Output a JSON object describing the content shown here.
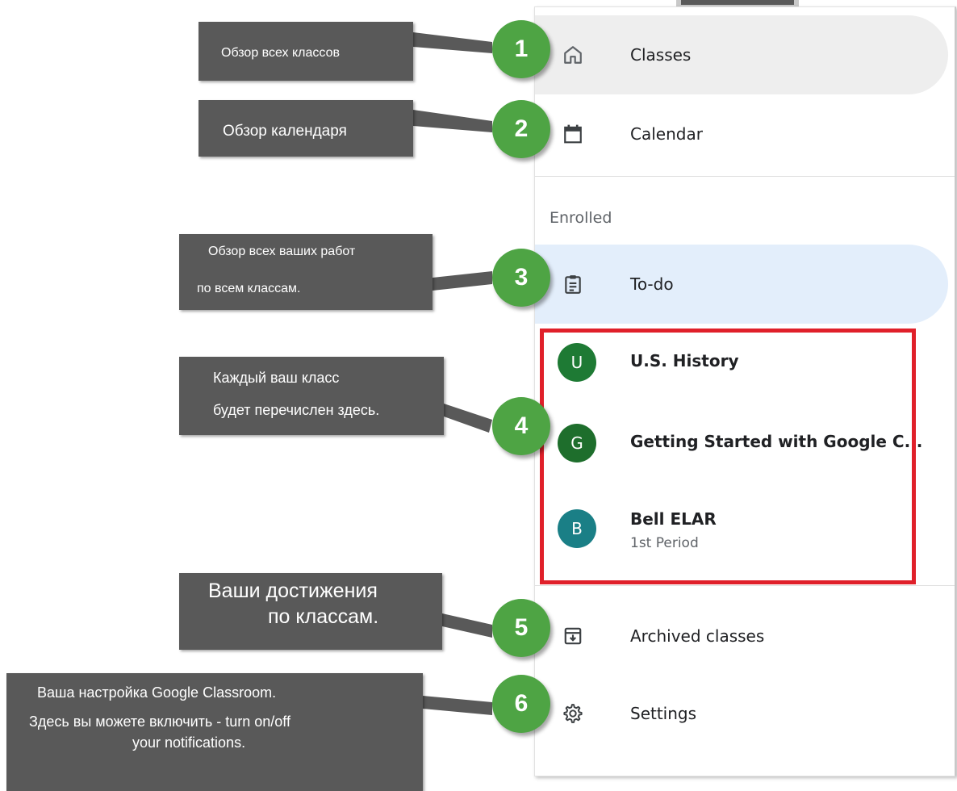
{
  "nav": {
    "classes_label": "Classes",
    "calendar_label": "Calendar",
    "section_enrolled": "Enrolled",
    "todo_label": "To-do",
    "archived_label": "Archived classes",
    "settings_label": "Settings"
  },
  "classes": [
    {
      "initial": "U",
      "name": "U.S. History",
      "subtitle": "",
      "color": "#1e7a34"
    },
    {
      "initial": "G",
      "name": "Getting Started with Google C...",
      "subtitle": "",
      "color": "#1e6e2c"
    },
    {
      "initial": "B",
      "name": "Bell ELAR",
      "subtitle": "1st Period",
      "color": "#1a7f86"
    }
  ],
  "callouts": {
    "c1": [
      "Обзор всех классов"
    ],
    "c2": [
      "Обзор календаря"
    ],
    "c3": [
      "Обзор всех ваших работ",
      "по всем классам."
    ],
    "c4": [
      "Каждый ваш класс",
      "будет перечислен здесь."
    ],
    "c5": [
      "Ваши достижения",
      "по классам."
    ],
    "c6": [
      "Ваша настройка Google Classroom.",
      "Здесь вы можете включить - turn on/off",
      "your notifications."
    ]
  },
  "badges": [
    "1",
    "2",
    "3",
    "4",
    "5",
    "6"
  ],
  "colors": {
    "badge": "#4ea444",
    "callout": "#595959",
    "highlight": "#e0202a",
    "todo_bg": "#e3eefb",
    "classes_bg": "#eeeeee"
  }
}
